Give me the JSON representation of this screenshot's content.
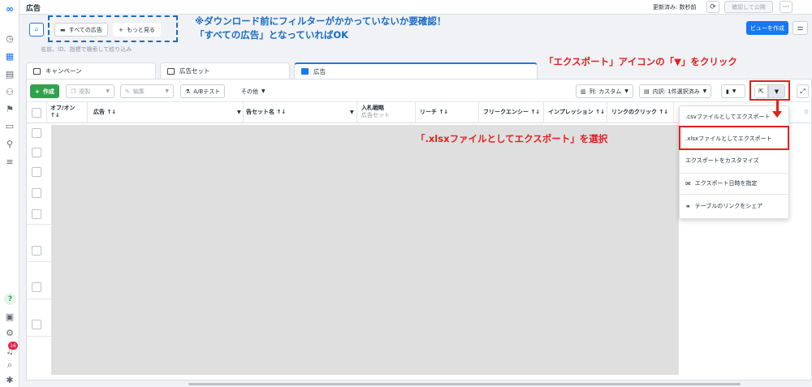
{
  "topbar": {
    "title": "広告",
    "updated": "更新済み: 数秒前",
    "publish_label": "確認して公開",
    "more_label": "···"
  },
  "search": {
    "chip_all_ads": "すべての広告",
    "chip_more": "もっと見る",
    "hint": "名前、ID、指標で検索して絞り込み"
  },
  "view_button": "ビューを作成",
  "annotations": {
    "blue_note_line1": "※ダウンロード前にフィルターがかかっていないか要確認！",
    "blue_note_line2": "「すべての広告」となっていればOK",
    "red_note_export": "「エクスポート」アイコンの「▼」をクリック",
    "red_note_xlsx": "「.xlsxファイルとしてエクスポート」を選択"
  },
  "tabs": [
    {
      "label": "キャンペーン"
    },
    {
      "label": "広告セット"
    },
    {
      "label": "広告"
    }
  ],
  "toolbar": {
    "create": "作成",
    "duplicate": "複製",
    "edit": "編集",
    "ab_test": "A/Bテスト",
    "other": "その他",
    "columns": "列: カスタム",
    "breakdown": "内訳: 1件選択済み"
  },
  "table": {
    "headers": {
      "onoff": "オフ/オン",
      "ad": "広告",
      "adset": "告セット名",
      "bid": "入札戦略",
      "bid_sub": "広告セット",
      "reach": "リーチ",
      "frequency": "フリークエンシー",
      "impressions": "インプレッション",
      "link_clicks": "リンクのクリック"
    },
    "sort_marker": "↑↓"
  },
  "dropdown": {
    "items": [
      {
        "label": ".csvファイルとしてエクスポート"
      },
      {
        "label": ".xlsxファイルとしてエクスポート"
      },
      {
        "label": "エクスポートをカスタマイズ"
      },
      {
        "label": "エクスポート日時を指定"
      },
      {
        "label": "テーブルのリンクをシェア"
      }
    ]
  },
  "rail": {
    "notification_count": "16"
  }
}
